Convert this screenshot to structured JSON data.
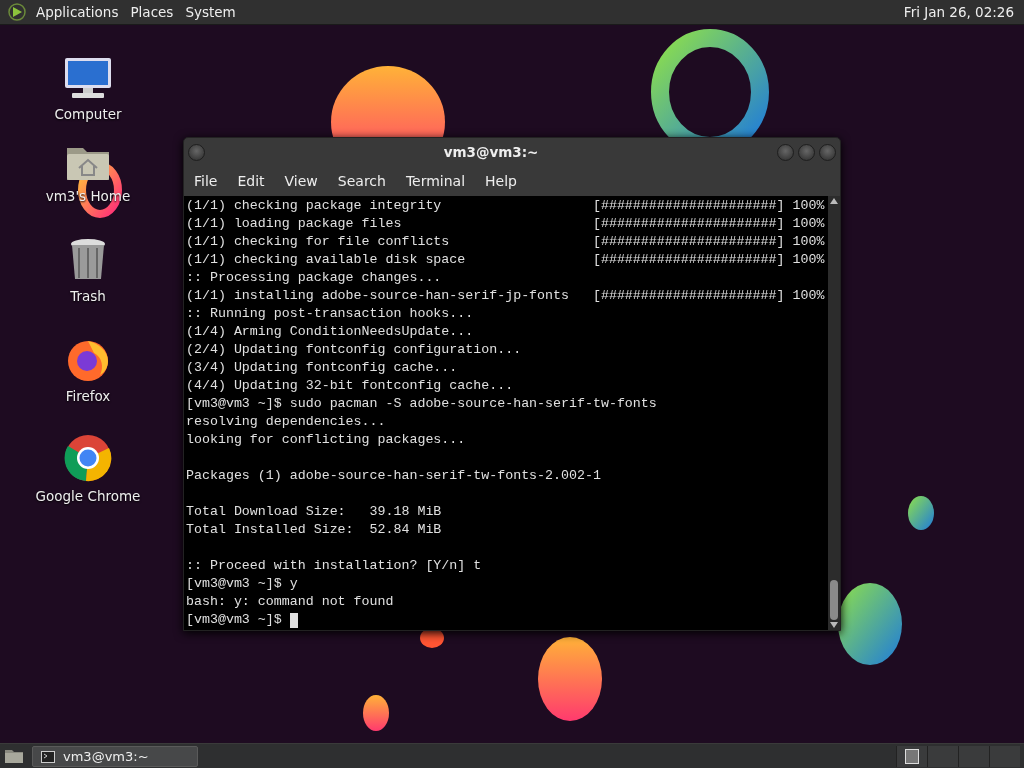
{
  "top_panel": {
    "menus": [
      "Applications",
      "Places",
      "System"
    ],
    "clock": "Fri Jan 26, 02:26"
  },
  "desktop_icons": [
    {
      "kind": "computer",
      "label": "Computer"
    },
    {
      "kind": "home",
      "label": "vm3's Home"
    },
    {
      "kind": "trash",
      "label": "Trash"
    },
    {
      "kind": "firefox",
      "label": "Firefox"
    },
    {
      "kind": "chrome",
      "label": "Google Chrome"
    }
  ],
  "window": {
    "title": "vm3@vm3:~",
    "menu": [
      "File",
      "Edit",
      "View",
      "Search",
      "Terminal",
      "Help"
    ],
    "output_blocks": [
      [
        "(1/1) checking package integrity                   [######################] 100%",
        "(1/1) loading package files                        [######################] 100%",
        "(1/1) checking for file conflicts                  [######################] 100%",
        "(1/1) checking available disk space                [######################] 100%",
        ":: Processing package changes...",
        "(1/1) installing adobe-source-han-serif-jp-fonts   [######################] 100%",
        ":: Running post-transaction hooks...",
        "(1/4) Arming ConditionNeedsUpdate...",
        "(2/4) Updating fontconfig configuration...",
        "(3/4) Updating fontconfig cache...",
        "(4/4) Updating 32-bit fontconfig cache...",
        "[vm3@vm3 ~]$ sudo pacman -S adobe-source-han-serif-tw-fonts",
        "resolving dependencies...",
        "looking for conflicting packages..."
      ],
      [
        "Packages (1) adobe-source-han-serif-tw-fonts-2.002-1"
      ],
      [
        "Total Download Size:   39.18 MiB",
        "Total Installed Size:  52.84 MiB"
      ],
      [
        ":: Proceed with installation? [Y/n] t",
        "[vm3@vm3 ~]$ y",
        "bash: y: command not found"
      ]
    ],
    "prompt": "[vm3@vm3 ~]$"
  },
  "taskbar": {
    "tasks": [
      {
        "label": "vm3@vm3:~",
        "selected": false
      }
    ],
    "workspaces": [
      {
        "selected": true
      },
      {
        "selected": false
      },
      {
        "selected": false
      },
      {
        "selected": false
      }
    ]
  }
}
